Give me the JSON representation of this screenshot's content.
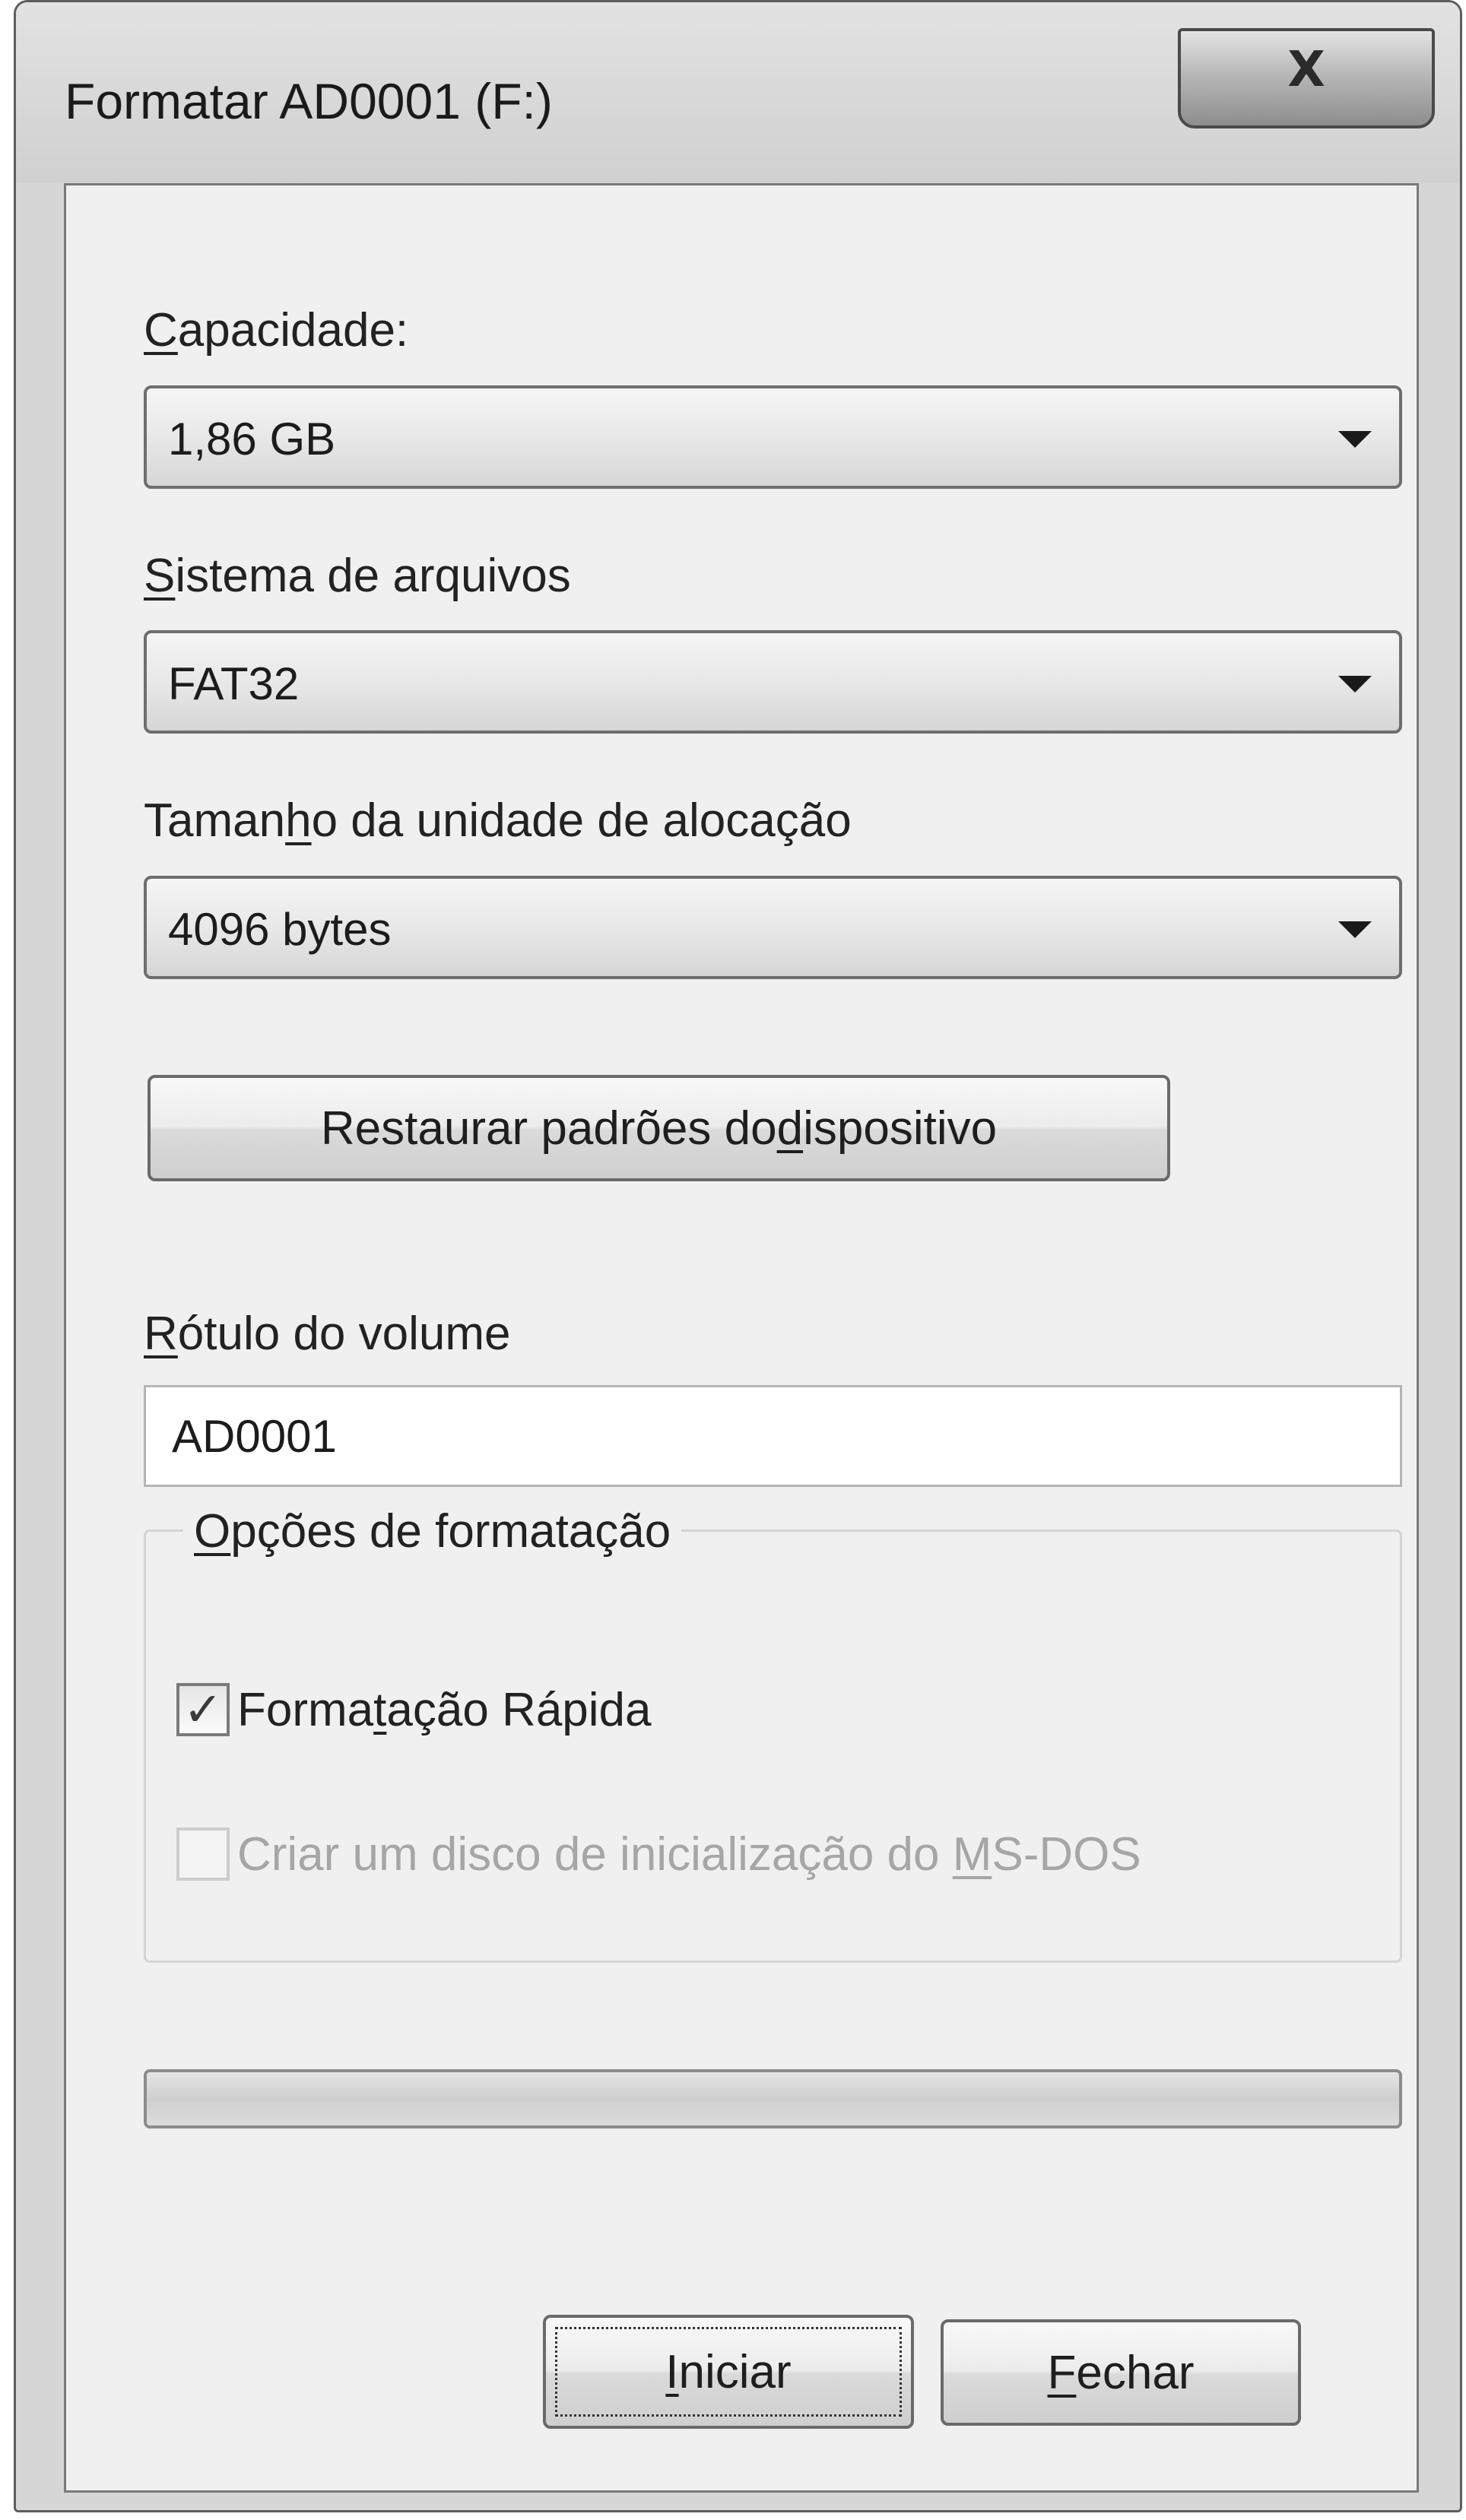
{
  "window": {
    "title": "Formatar AD0001 (F:)",
    "close_glyph": "X",
    "close_icon": "close-icon"
  },
  "capacity": {
    "label_mnemonic": "C",
    "label_rest": "apacidade:",
    "value": "1,86 GB"
  },
  "filesystem": {
    "label_mnemonic": "S",
    "label_rest": "istema de arquivos",
    "value": "FAT32"
  },
  "allocation": {
    "label_before": "Taman",
    "label_mnemonic": "h",
    "label_after": "o da unidade de alocação",
    "value": "4096 bytes"
  },
  "restore_button": {
    "label_before": "Restaurar padrões do ",
    "label_mnemonic": "d",
    "label_after": "ispositivo"
  },
  "volume_label": {
    "label_mnemonic": "R",
    "label_rest": "ótulo do volume",
    "value": "AD0001"
  },
  "format_options": {
    "legend_mnemonic": "O",
    "legend_rest": "pções de formatação",
    "quick_format": {
      "label_before": "Forma",
      "label_mnemonic": "t",
      "label_after": "ação Rápida",
      "checked": true,
      "check_glyph": "✓"
    },
    "msdos_disk": {
      "label_before": "Criar um disco de inicialização do ",
      "label_mnemonic": "M",
      "label_after": "S-DOS",
      "checked": false,
      "enabled": false
    }
  },
  "progress": {
    "value": 0
  },
  "buttons": {
    "start": {
      "label_mnemonic": "I",
      "label_rest": "niciar"
    },
    "close": {
      "label_mnemonic": "F",
      "label_rest": "echar"
    }
  }
}
